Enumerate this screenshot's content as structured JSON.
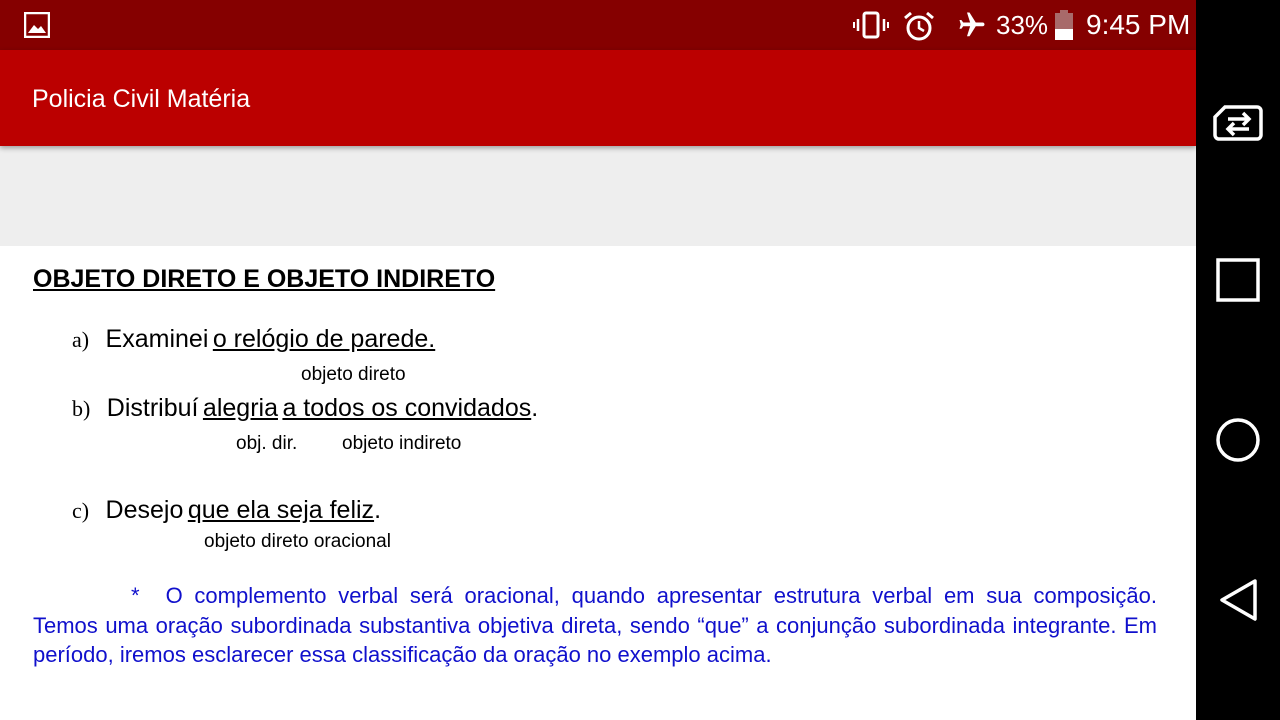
{
  "status_bar": {
    "battery_percent": "33%",
    "time": "9:45 PM",
    "icons": [
      "gallery-icon",
      "vibrate-icon",
      "alarm-icon",
      "airplane-mode-icon",
      "battery-icon"
    ]
  },
  "app_bar": {
    "title": "Policia Civil Matéria"
  },
  "document": {
    "title": "OBJETO DIRETO E OBJETO INDIRETO",
    "items": [
      {
        "letter": "a)",
        "verb": "Examinei",
        "object": "o relógio de parede.",
        "labels": [
          "objeto direto"
        ]
      },
      {
        "letter": "b)",
        "verb": "Distribuí",
        "object_direct": "alegria",
        "object_indirect": "a todos os convidados",
        "end": ".",
        "labels": [
          "obj. dir.",
          "objeto indireto"
        ]
      },
      {
        "letter": "c)",
        "verb": "Desejo",
        "object": "que ela seja feliz",
        "end": ".",
        "labels": [
          "objeto direto oracional"
        ]
      }
    ],
    "note": {
      "marker": "*",
      "text": "O complemento verbal será oracional, quando apresentar estrutura verbal em sua composição.  Temos uma oração subordinada substantiva objetiva direta, sendo “que” a conjunção subordinada integrante.  Em período, iremos esclarecer essa classificação da oração no exemplo acima."
    }
  },
  "nav_bar": {
    "buttons": [
      "switch-sim-icon",
      "recents-button",
      "home-button",
      "back-button"
    ]
  },
  "colors": {
    "status_bar": "#850000",
    "app_bar": "#bb0000",
    "note_text": "#1010cc"
  }
}
